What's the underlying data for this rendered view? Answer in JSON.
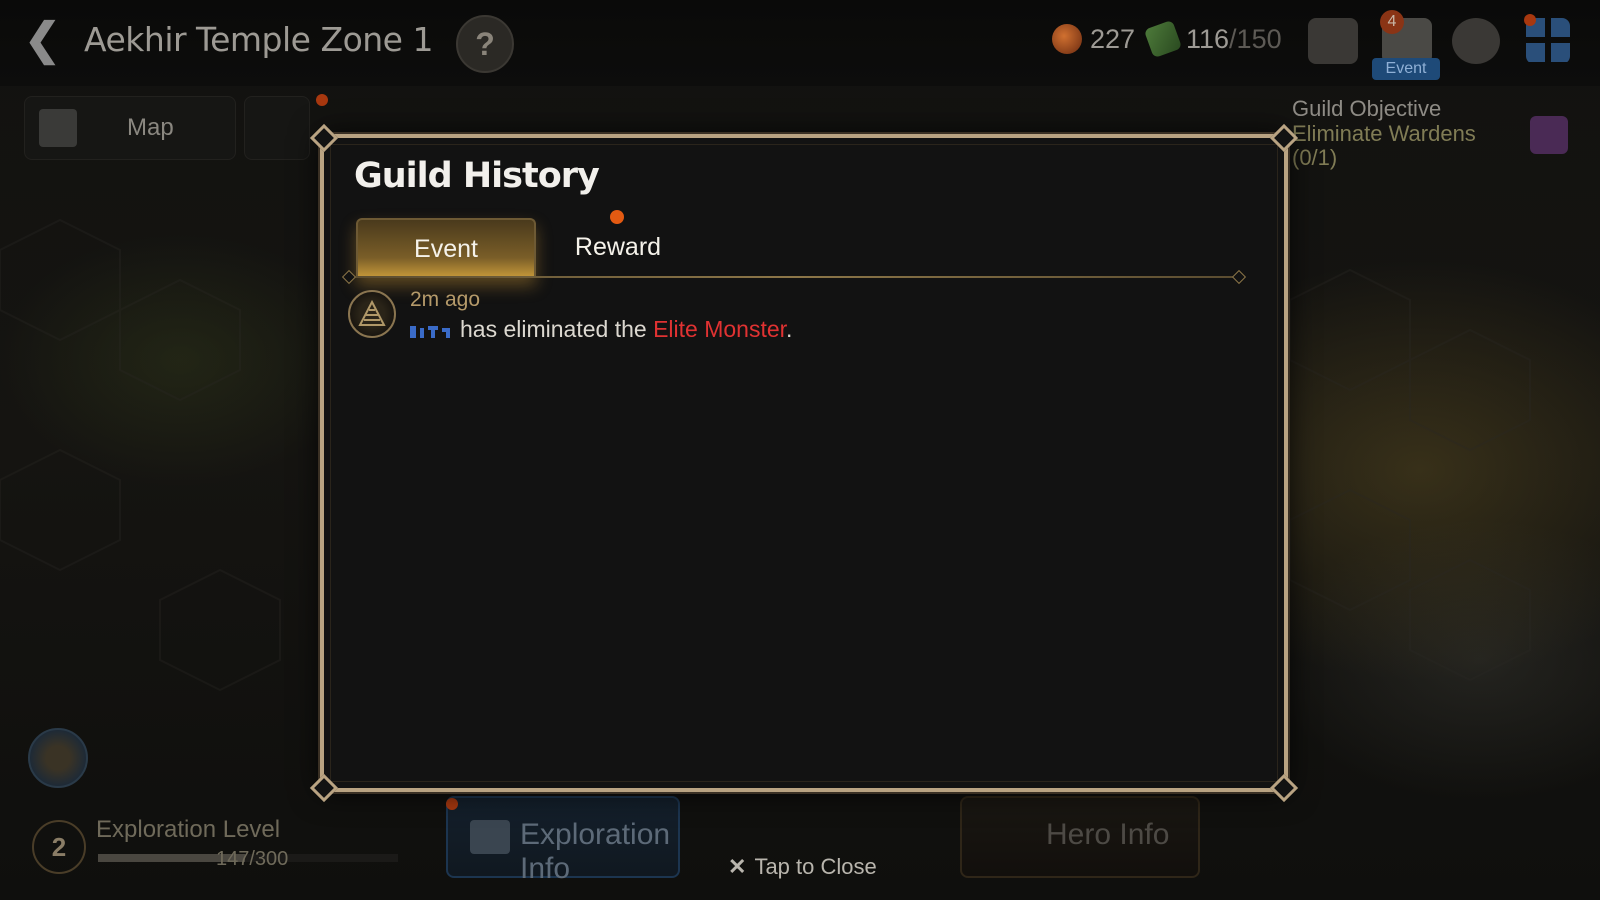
{
  "header": {
    "zone_title": "Aekhir Temple Zone 1",
    "help_label": "?",
    "currency_1": "227",
    "currency_2_value": "116",
    "currency_2_max": "/150",
    "mail_badge": "4",
    "event_label": "Event"
  },
  "left_panel": {
    "map_label": "Map"
  },
  "guild_objective": {
    "heading": "Guild Objective",
    "task": "Eliminate Wardens",
    "progress": "(0/1)"
  },
  "exploration": {
    "level": "2",
    "label": "Exploration Level",
    "value": "147/300",
    "fill_fraction": 0.49
  },
  "bottom_bar": {
    "exploration_info_label": "Exploration Info",
    "hero_info_label": "Hero Info"
  },
  "modal": {
    "title": "Guild History",
    "tabs": [
      {
        "label": "Event",
        "active": true
      },
      {
        "label": "Reward",
        "active": false,
        "has_notification": true
      }
    ],
    "entries": [
      {
        "time": "2m ago",
        "text_before": "has eliminated the ",
        "highlight": "Elite Monster",
        "text_after": "."
      }
    ],
    "close_label": "Tap to Close"
  },
  "colors": {
    "accent_gold": "#b9a382",
    "highlight_red": "#e03232",
    "notification_orange": "#e35a12"
  }
}
